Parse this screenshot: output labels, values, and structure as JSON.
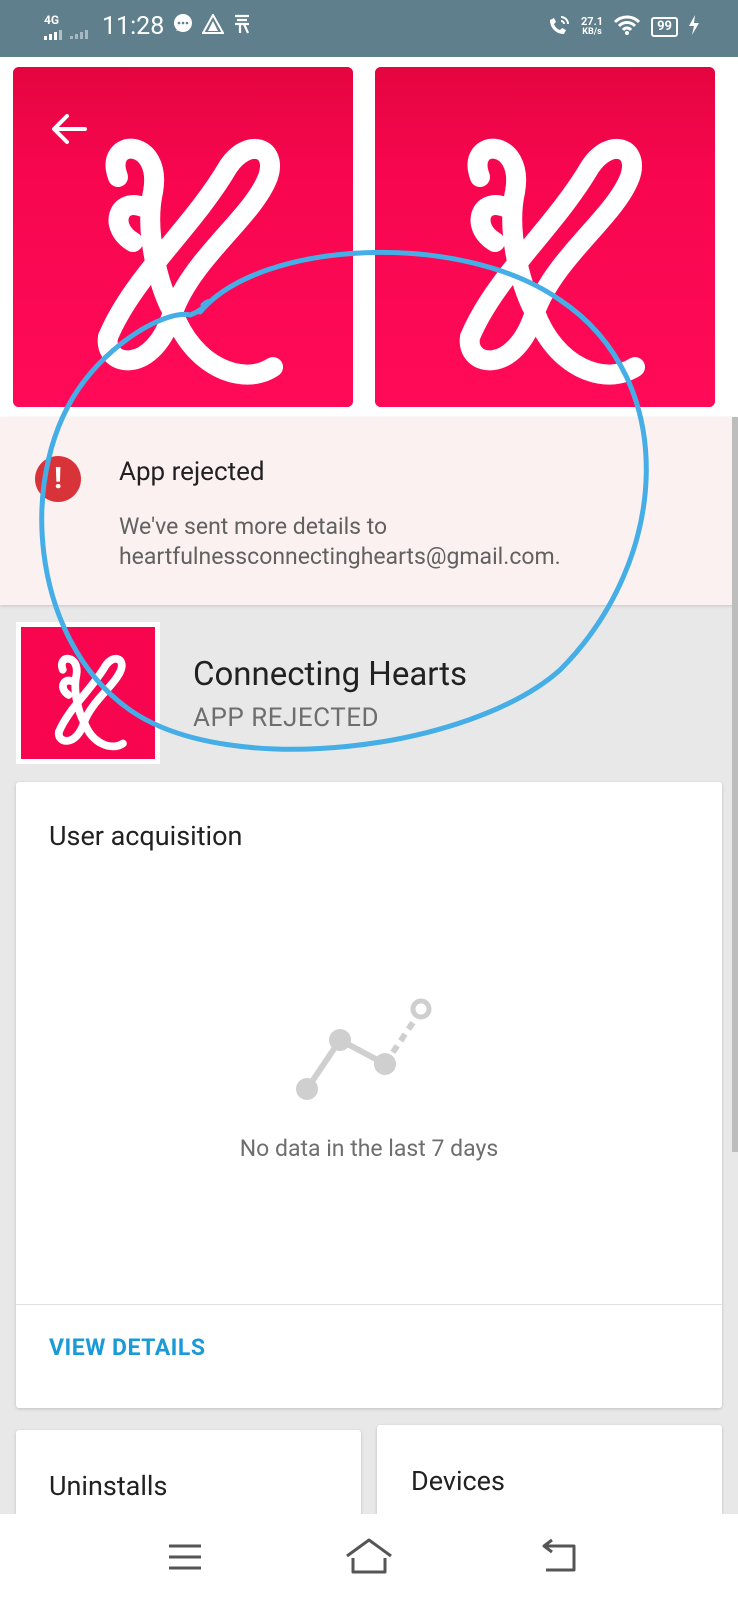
{
  "status_bar": {
    "network": "4G",
    "time": "11:28",
    "speed_value": "27.1",
    "speed_unit": "KB/s",
    "battery": "99"
  },
  "banner": {
    "title": "App rejected",
    "line1": "We've sent more details to",
    "line2": "heartfulnessconnectinghearts@gmail.com."
  },
  "app": {
    "name": "Connecting Hearts",
    "status": "APP REJECTED"
  },
  "user_acquisition": {
    "title": "User acquisition",
    "empty_message": "No data in the last 7 days",
    "action": "VIEW DETAILS"
  },
  "mini_cards": {
    "uninstalls": "Uninstalls",
    "devices": "Devices"
  },
  "colors": {
    "status_bar": "#5f7f8c",
    "brand": "#f7064f",
    "error": "#d9333a",
    "link": "#1a9ad6",
    "annotation": "#45aee6"
  },
  "icons": [
    "back-arrow-icon",
    "error-icon",
    "app-logo-icon",
    "empty-chart-icon",
    "menu-icon",
    "home-icon",
    "back-icon"
  ]
}
